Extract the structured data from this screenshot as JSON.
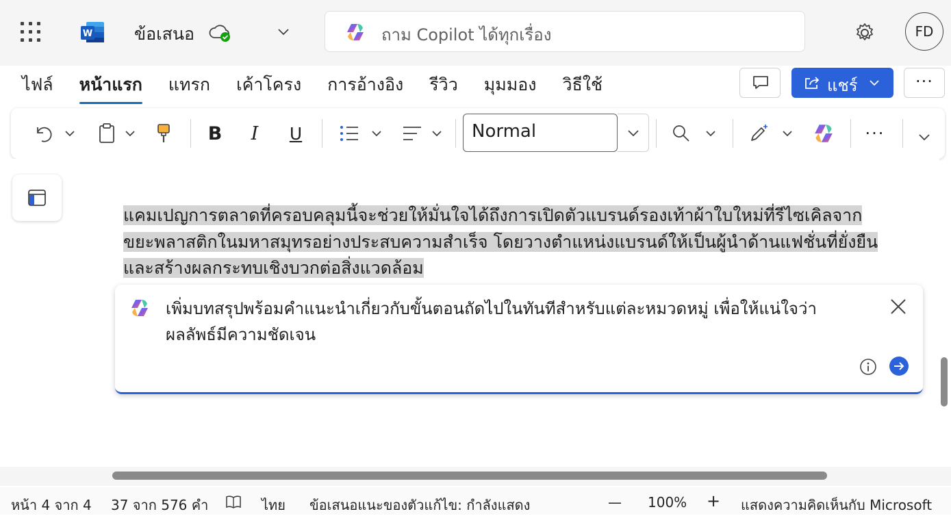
{
  "app": {
    "doc_title": "ข้อเสนอ",
    "search_placeholder": "ถาม Copilot ได้ทุกเรื่อง",
    "avatar_initials": "FD",
    "brand_color": "#2b62d9"
  },
  "tabs": [
    {
      "label": "ไฟล์"
    },
    {
      "label": "หน้าแรก"
    },
    {
      "label": "แทรก"
    },
    {
      "label": "เค้าโครง"
    },
    {
      "label": "การอ้างอิง"
    },
    {
      "label": "รีวิว"
    },
    {
      "label": "มุมมอง"
    },
    {
      "label": "วิธีใช้"
    }
  ],
  "actions": {
    "share_label": "แชร์",
    "more_label": "···"
  },
  "ribbon": {
    "style_value": "Normal",
    "bold": "B",
    "italic": "I",
    "underline": "U",
    "more": "···"
  },
  "document": {
    "paragraph_lines": [
      "แคมเปญการตลาดที่ครอบคลุมนี้จะช่วยให้มั่นใจได้ถึงการเปิดตัวแบรนด์รองเท้าผ้าใบใหม่ที่รีไซเคิลจาก",
      "ขยะพลาสติกในมหาสมุทรอย่างประสบความสำเร็จ โดยวางตำแหน่งแบรนด์ให้เป็นผู้นำด้านแฟชั่นที่ยั่งยืน",
      "และสร้างผลกระทบเชิงบวกต่อสิ่งแวดล้อม"
    ]
  },
  "copilot": {
    "prompt_lines": [
      "เพิ่มบทสรุปพร้อมคำแนะนำเกี่ยวกับขั้นตอนถัดไปในทันทีสำหรับแต่ละหมวดหมู่ เพื่อให้แน่ใจว่า",
      "ผลลัพธ์มีความชัดเจน"
    ]
  },
  "statusbar": {
    "page": "หน้า 4 จาก 4",
    "words": "37 จาก 576 คำ",
    "language": "ไทย",
    "suggestions": "ข้อเสนอแนะของตัวแก้ไข: กำลังแสดง",
    "zoom_out": "—",
    "zoom": "100%",
    "zoom_in": "+",
    "feedback": "แสดงความคิดเห็นกับ Microsoft"
  }
}
